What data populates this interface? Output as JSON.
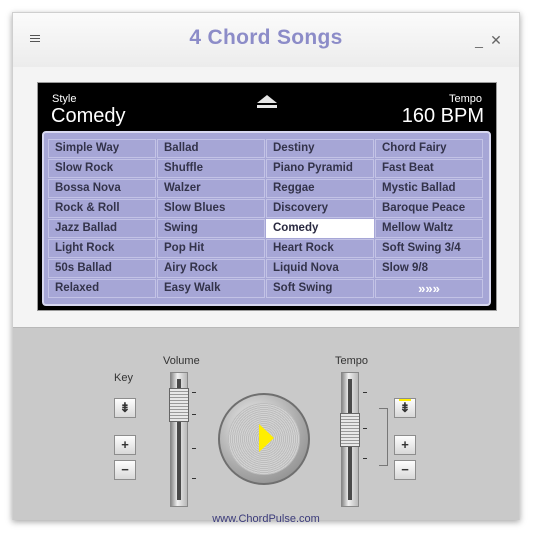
{
  "window": {
    "title": "4 Chord Songs",
    "menu_icon": "hamburger-icon",
    "minimize_glyph": "_",
    "close_glyph": "✕"
  },
  "display": {
    "style_label": "Style",
    "style_value": "Comedy",
    "tempo_label": "Tempo",
    "tempo_value": "160 BPM",
    "eject_icon": "eject-icon"
  },
  "styles": [
    "Simple Way",
    "Ballad",
    "Destiny",
    "Chord Fairy",
    "Slow Rock",
    "Shuffle",
    "Piano Pyramid",
    "Fast Beat",
    "Bossa Nova",
    "Walzer",
    "Reggae",
    "Mystic Ballad",
    "Rock & Roll",
    "Slow Blues",
    "Discovery",
    "Baroque Peace",
    "Jazz Ballad",
    "Swing",
    "Comedy",
    "Mellow Waltz",
    "Light Rock",
    "Pop Hit",
    "Heart Rock",
    "Soft Swing 3/4",
    "50s Ballad",
    "Airy Rock",
    "Liquid Nova",
    "Slow 9/8",
    "Relaxed",
    "Easy Walk",
    "Soft Swing",
    "»»»"
  ],
  "selected_style": "Comedy",
  "controls": {
    "key_label": "Key",
    "volume_label": "Volume",
    "tempo_label": "Tempo",
    "plus": "+",
    "minus": "−",
    "reset": "⇟",
    "volume_level": 0.85,
    "tempo_level": 0.6,
    "play_icon": "play-icon",
    "play_color": "#ffee00"
  },
  "footer": {
    "url": "www.ChordPulse.com"
  }
}
